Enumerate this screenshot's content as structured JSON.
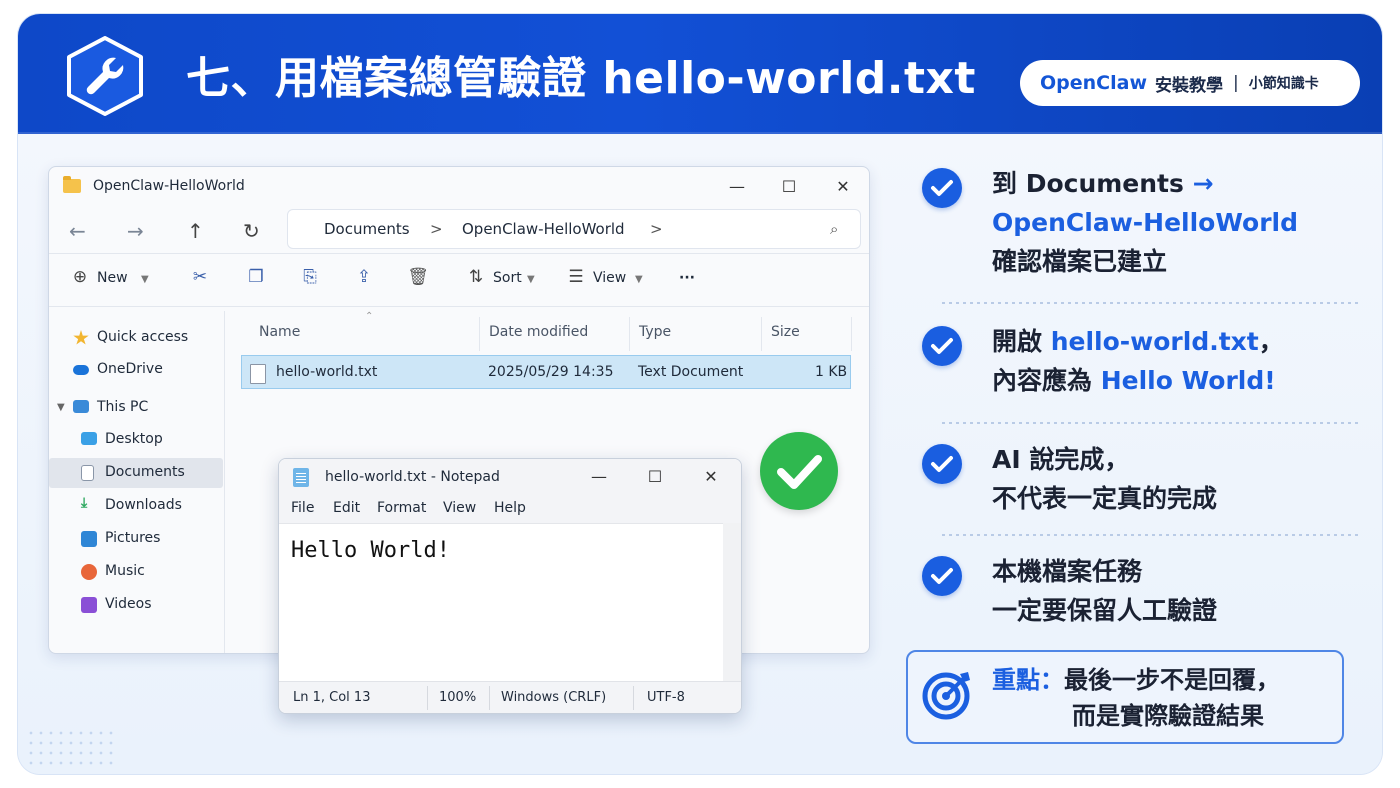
{
  "banner": {
    "title": "七、用檔案總管驗證 hello-world.txt",
    "brand": "OpenClaw",
    "course": "安裝教學",
    "separator": "|",
    "series": "小節知識卡",
    "icon": "wrench-icon"
  },
  "explorer": {
    "window_title": "OpenClaw-HelloWorld",
    "breadcrumb": [
      "Documents",
      ">",
      "OpenClaw-HelloWorld",
      ">"
    ],
    "toolbar": {
      "new_label": "New",
      "sort_label": "Sort",
      "view_label": "View",
      "more_label": "···"
    },
    "nav_items": [
      {
        "label": "Quick access",
        "icon": "star-icon",
        "color": "#f2b530"
      },
      {
        "label": "OneDrive",
        "icon": "cloud-icon",
        "color": "#1a73d9"
      },
      {
        "label": "This PC",
        "icon": "computer-icon",
        "color": "#3a8ad8"
      },
      {
        "label": "Desktop",
        "icon": "desktop-icon",
        "color": "#3aa0e6"
      },
      {
        "label": "Documents",
        "icon": "document-icon",
        "color": "#8a96a8"
      },
      {
        "label": "Downloads",
        "icon": "download-icon",
        "color": "#2fa860"
      },
      {
        "label": "Pictures",
        "icon": "pictures-icon",
        "color": "#2f86d6"
      },
      {
        "label": "Music",
        "icon": "music-icon",
        "color": "#e8663a"
      },
      {
        "label": "Videos",
        "icon": "video-icon",
        "color": "#8a4fd6"
      }
    ],
    "columns": [
      "Name",
      "Date modified",
      "Type",
      "Size"
    ],
    "rows": [
      {
        "name": "hello-world.txt",
        "date_modified": "2025/05/29 14:35",
        "type": "Text Document",
        "size": "1 KB"
      }
    ]
  },
  "notepad": {
    "window_title": "hello-world.txt - Notepad",
    "menu": [
      "File",
      "Edit",
      "Format",
      "View",
      "Help"
    ],
    "content": "Hello World!",
    "status": {
      "position": "Ln 1, Col 13",
      "zoom": "100%",
      "line_ending": "Windows (CRLF)",
      "encoding": "UTF-8"
    }
  },
  "points": [
    {
      "line1_a": "到 Documents ",
      "line1_b": "→",
      "line2": "OpenClaw-HelloWorld",
      "line3": "確認檔案已建立"
    },
    {
      "line1_a": "開啟 ",
      "line1_b": "hello-world.txt",
      "line1_c": "，",
      "line2_a": "內容應為 ",
      "line2_b": "Hello World!"
    },
    {
      "line1": "AI 說完成，",
      "line2": "不代表一定真的完成"
    },
    {
      "line1": "本機檔案任務",
      "line2": "一定要保留人工驗證"
    }
  ],
  "key_point": {
    "label": "重點：",
    "line1": "最後一步不是回覆，",
    "line2": "而是實際驗證結果"
  },
  "colors": {
    "banner": "#1250d6",
    "accent": "#1b5fe0",
    "success": "#2fb84f"
  }
}
